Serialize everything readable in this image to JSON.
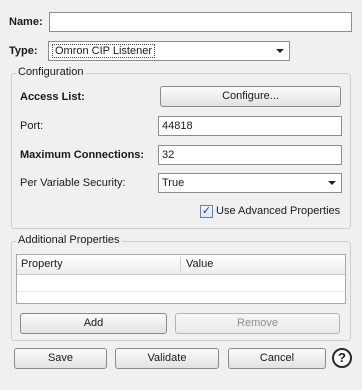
{
  "form": {
    "name_label": "Name:",
    "name_value": "",
    "type_label": "Type:",
    "type_value": "Omron CIP Listener"
  },
  "configuration": {
    "title": "Configuration",
    "access_list_label": "Access List:",
    "configure_button": "Configure...",
    "port_label": "Port:",
    "port_value": "44818",
    "max_connections_label": "Maximum Connections:",
    "max_connections_value": "32",
    "per_variable_security_label": "Per Variable Security:",
    "per_variable_security_value": "True",
    "use_advanced_label": "Use Advanced Properties",
    "use_advanced_checked": true
  },
  "additional_properties": {
    "title": "Additional Properties",
    "columns": [
      "Property",
      "Value"
    ],
    "rows": [],
    "add_button": "Add",
    "remove_button": "Remove"
  },
  "footer": {
    "save_button": "Save",
    "validate_button": "Validate",
    "cancel_button": "Cancel",
    "help_glyph": "?"
  },
  "icons": {
    "dropdown": "chevron-down-icon",
    "checkbox": "checkmark-icon",
    "help": "question-circle-icon"
  }
}
